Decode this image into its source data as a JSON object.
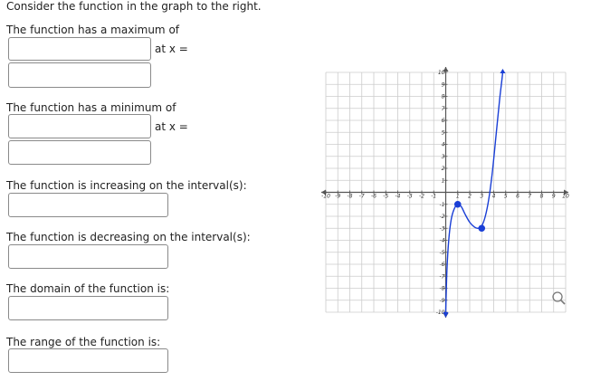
{
  "question": {
    "prompt": "Consider the function in the graph to the right.",
    "max_label": "The function has a maximum of",
    "min_label": "The function has a minimum of",
    "at_x_label": "at x =",
    "increasing_label": "The function is increasing on the interval(s):",
    "decreasing_label": "The function is decreasing on the interval(s):",
    "domain_label": "The domain of the function is:",
    "range_label": "The range of the function is:"
  },
  "answers": {
    "max_value": "",
    "max_x": "",
    "min_value": "",
    "min_x": "",
    "increasing": "",
    "decreasing": "",
    "domain": "",
    "range": ""
  },
  "icons": {
    "zoom": "magnifier-icon"
  },
  "colors": {
    "curve": "#1a3fd6",
    "point": "#1a3fd6",
    "grid": "#cccccc",
    "axis": "#555555"
  },
  "chart_data": {
    "type": "line",
    "title": "",
    "xlabel": "",
    "ylabel": "",
    "xlim": [
      -10,
      10
    ],
    "ylim": [
      -10,
      10
    ],
    "grid": true,
    "x_ticks": [
      -10,
      -9,
      -8,
      -7,
      -6,
      -5,
      -4,
      -3,
      -2,
      -1,
      1,
      2,
      3,
      4,
      5,
      6,
      7,
      8,
      9,
      10
    ],
    "y_ticks": [
      -10,
      -9,
      -8,
      -7,
      -6,
      -5,
      -4,
      -3,
      -2,
      -1,
      1,
      2,
      3,
      4,
      5,
      6,
      7,
      8,
      9,
      10
    ],
    "series": [
      {
        "x": [
          0.0,
          0.1,
          0.25,
          0.45,
          0.7,
          1.0,
          1.3,
          1.6,
          2.0,
          2.4,
          2.7,
          3.0,
          3.3,
          3.6,
          3.9,
          4.2,
          4.5,
          4.75,
          5.0
        ],
        "y": [
          -10,
          -6.5,
          -4.0,
          -2.3,
          -1.4,
          -1.0,
          -1.2,
          -1.8,
          -2.5,
          -2.9,
          -3.0,
          -2.8,
          -2.0,
          -0.5,
          1.8,
          4.8,
          7.8,
          10.0,
          13.0
        ]
      }
    ],
    "points": [
      {
        "x": 1,
        "y": -1
      },
      {
        "x": 3,
        "y": -3
      }
    ],
    "arrows": {
      "start": "down",
      "end": "up"
    }
  }
}
